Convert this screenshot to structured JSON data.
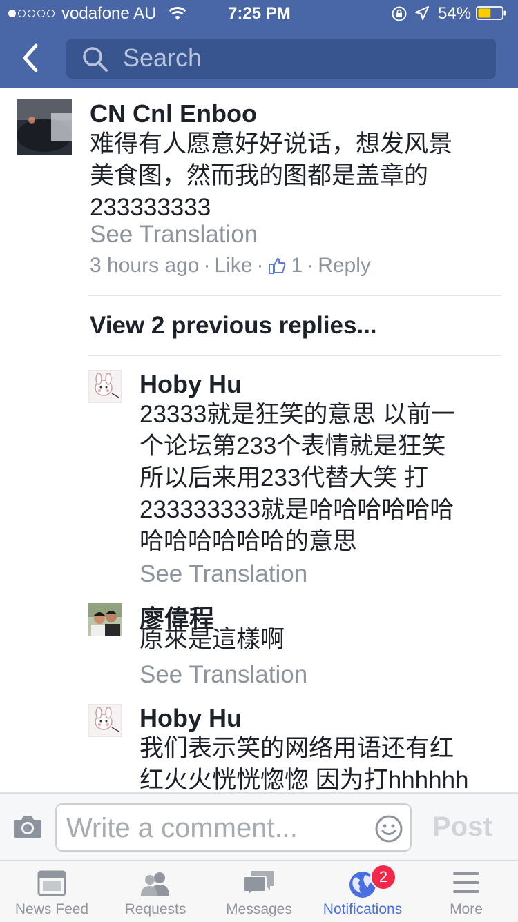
{
  "status_bar": {
    "carrier": "vodafone AU",
    "time": "7:25 PM",
    "battery_percent": "54%",
    "battery_level": 0.54,
    "signal_bars": 1
  },
  "nav": {
    "search_placeholder": "Search"
  },
  "thread": {
    "comment": {
      "author": "CN Cnl Enboo",
      "text_lines": [
        "难得有人愿意好好说话，想发风景",
        "美食图，然而我的图都是盖章的",
        "233333333"
      ],
      "see_translation": "See Translation",
      "time": "3 hours ago",
      "like": "Like",
      "like_count": "1",
      "reply": "Reply",
      "dot": "·"
    },
    "view_previous": "View 2 previous replies...",
    "replies": [
      {
        "author": "Hoby Hu",
        "text_lines": [
          "23333就是狂笑的意思 以前一",
          "个论坛第233个表情就是狂笑",
          "所以后来用233代替大笑 打",
          "233333333就是哈哈哈哈哈哈",
          "哈哈哈哈哈哈的意思"
        ],
        "see_translation": "See Translation"
      },
      {
        "author": "廖偉程",
        "text_lines": [
          "原來是這樣啊"
        ],
        "see_translation": "See Translation"
      },
      {
        "author": "Hoby Hu",
        "text_lines": [
          "我们表示笑的网络用语还有红",
          "红火火恍恍惚惚 因为打hhhhhh"
        ]
      }
    ]
  },
  "composer": {
    "placeholder": "Write a comment...",
    "post": "Post"
  },
  "tabs": [
    {
      "label": "News Feed",
      "icon": "news-feed-icon"
    },
    {
      "label": "Requests",
      "icon": "friend-requests-icon"
    },
    {
      "label": "Messages",
      "icon": "messages-icon"
    },
    {
      "label": "Notifications",
      "icon": "globe-icon",
      "badge": "2",
      "active": true
    },
    {
      "label": "More",
      "icon": "menu-icon"
    }
  ],
  "colors": {
    "brand_blue": "#4967a6",
    "active_tab": "#4a6fe0",
    "badge_red": "#f02849",
    "secondary_text": "#8d949e",
    "battery_fill": "#ffcc00"
  }
}
